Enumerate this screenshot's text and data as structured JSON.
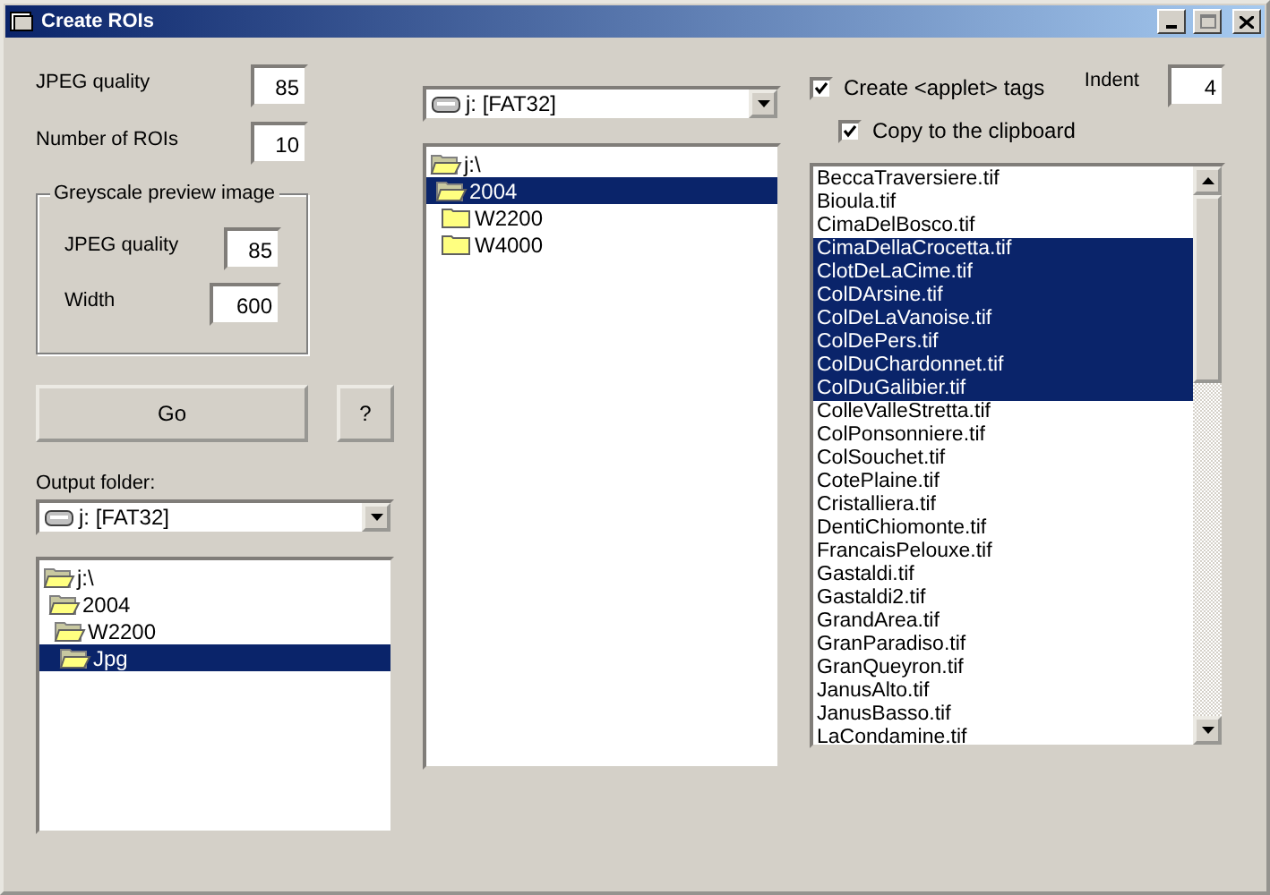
{
  "window": {
    "title": "Create ROIs"
  },
  "settings": [
    {
      "label": "JPEG quality",
      "value": "85"
    },
    {
      "label": "Number of ROIs",
      "value": "10"
    }
  ],
  "preview_group": {
    "title": "Greyscale preview image",
    "fields": [
      {
        "label": "JPEG quality",
        "value": "85"
      },
      {
        "label": "Width",
        "value": "600"
      }
    ]
  },
  "buttons": [
    {
      "label": "Go",
      "kind": "wide"
    },
    {
      "label": "?",
      "kind": "small"
    }
  ],
  "output_folder": {
    "label": "Output folder:",
    "drive": "j: [FAT32]",
    "tree": [
      {
        "label": "j:\\",
        "open": true,
        "selected": false,
        "children": [
          {
            "label": "2004",
            "open": true,
            "selected": false,
            "children": [
              {
                "label": "W2200",
                "open": true,
                "selected": false,
                "children": [
                  {
                    "label": "Jpg",
                    "open": true,
                    "selected": true
                  }
                ]
              }
            ]
          }
        ]
      }
    ]
  },
  "source_folder": {
    "drive": "j: [FAT32]",
    "tree": [
      {
        "label": "j:\\",
        "open": true,
        "selected": false,
        "children": [
          {
            "label": "2004",
            "open": true,
            "selected": true,
            "children": [
              {
                "label": "W2200",
                "open": false,
                "selected": false
              },
              {
                "label": "W4000",
                "open": false,
                "selected": false
              }
            ]
          }
        ]
      }
    ]
  },
  "options": {
    "checkboxes": [
      {
        "label": "Create <applet> tags",
        "checked": true
      },
      {
        "label": "Copy to the clipboard",
        "checked": true
      }
    ],
    "indent": {
      "label": "Indent",
      "value": "4"
    }
  },
  "files": [
    {
      "name": "BeccaTraversiere.tif",
      "selected": false
    },
    {
      "name": "Bioula.tif",
      "selected": false
    },
    {
      "name": "CimaDelBosco.tif",
      "selected": false
    },
    {
      "name": "CimaDellaCrocetta.tif",
      "selected": true
    },
    {
      "name": "ClotDeLaCime.tif",
      "selected": true
    },
    {
      "name": "ColDArsine.tif",
      "selected": true
    },
    {
      "name": "ColDeLaVanoise.tif",
      "selected": true
    },
    {
      "name": "ColDePers.tif",
      "selected": true
    },
    {
      "name": "ColDuChardonnet.tif",
      "selected": true
    },
    {
      "name": "ColDuGalibier.tif",
      "selected": true
    },
    {
      "name": "ColleValleStretta.tif",
      "selected": false
    },
    {
      "name": "ColPonsonniere.tif",
      "selected": false
    },
    {
      "name": "ColSouchet.tif",
      "selected": false
    },
    {
      "name": "CotePlaine.tif",
      "selected": false
    },
    {
      "name": "Cristalliera.tif",
      "selected": false
    },
    {
      "name": "DentiChiomonte.tif",
      "selected": false
    },
    {
      "name": "FrancaisPelouxe.tif",
      "selected": false
    },
    {
      "name": "Gastaldi.tif",
      "selected": false
    },
    {
      "name": "Gastaldi2.tif",
      "selected": false
    },
    {
      "name": "GrandArea.tif",
      "selected": false
    },
    {
      "name": "GranParadiso.tif",
      "selected": false
    },
    {
      "name": "GranQueyron.tif",
      "selected": false
    },
    {
      "name": "JanusAlto.tif",
      "selected": false
    },
    {
      "name": "JanusBasso.tif",
      "selected": false
    },
    {
      "name": "LaCondamine.tif",
      "selected": false
    }
  ]
}
